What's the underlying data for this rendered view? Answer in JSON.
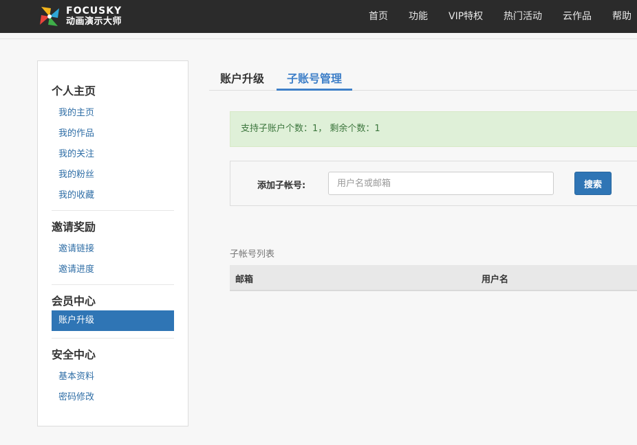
{
  "header": {
    "logo_en": "FOCUSKY",
    "logo_cn": "动画演示大师",
    "nav": [
      {
        "label": "首页"
      },
      {
        "label": "功能"
      },
      {
        "label": "VIP特权"
      },
      {
        "label": "热门活动"
      },
      {
        "label": "云作品"
      },
      {
        "label": "帮助"
      }
    ]
  },
  "sidebar": {
    "sections": [
      {
        "title": "个人主页",
        "items": [
          "我的主页",
          "我的作品",
          "我的关注",
          "我的粉丝",
          "我的收藏"
        ]
      },
      {
        "title": "邀请奖励",
        "items": [
          "邀请链接",
          "邀请进度"
        ]
      },
      {
        "title": "会员中心",
        "items": [
          "账户升级"
        ]
      },
      {
        "title": "安全中心",
        "items": [
          "基本资料",
          "密码修改"
        ]
      }
    ],
    "active_item": "账户升级"
  },
  "tabs": [
    {
      "label": "账户升级",
      "active": false
    },
    {
      "label": "子账号管理",
      "active": true
    }
  ],
  "alert": {
    "text": "支持子账户个数：1， 剩余个数：1"
  },
  "add_sub": {
    "label": "添加子帐号:",
    "placeholder": "用户名或邮箱",
    "value": "",
    "button": "搜索"
  },
  "sub_list": {
    "title": "子帐号列表",
    "columns": [
      "邮箱",
      "用户名"
    ],
    "rows": []
  },
  "colors": {
    "topbar": "#2b2b2b",
    "accent": "#2f75b5",
    "tab_active": "#3e7fc8",
    "alert_bg": "#dff0d8",
    "alert_text": "#3c763d",
    "link": "#2f6ea6"
  },
  "icons": {
    "logo": "focusky-pinwheel-logo"
  }
}
